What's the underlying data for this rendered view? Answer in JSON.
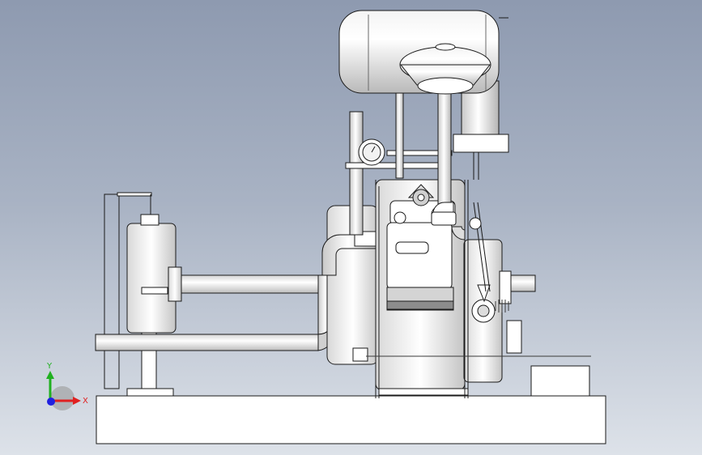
{
  "viewport": {
    "background_top": "#8e9ab0",
    "background_bottom": "#dde2e9",
    "model_line_color": "#1a1a1a",
    "model_fill_light": "#ffffff",
    "model_fill_shade": "#c8c8c8"
  },
  "triad": {
    "x_label": "X",
    "y_label": "Y",
    "x_color": "#e02020",
    "y_color": "#20b020",
    "z_color": "#2020e0"
  }
}
